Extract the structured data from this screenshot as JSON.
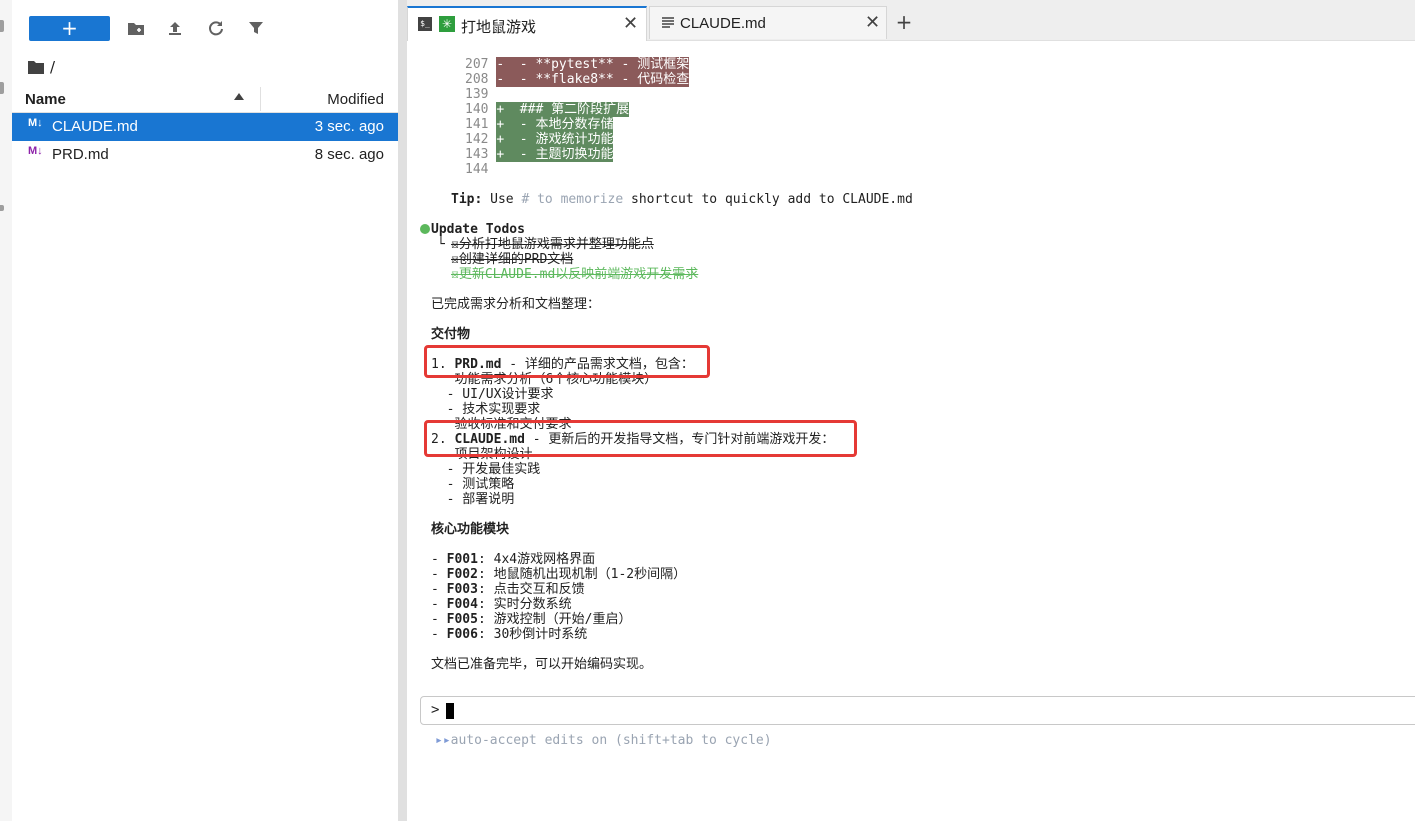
{
  "filebrowser": {
    "new_button_label": "+",
    "toolbar_icons": [
      "new-folder-icon",
      "upload-icon",
      "refresh-icon",
      "filter-icon"
    ],
    "breadcrumb": "/",
    "columns": {
      "name": "Name",
      "modified": "Modified"
    },
    "files": [
      {
        "icon_label": "M↓",
        "name": "CLAUDE.md",
        "modified": "3 sec. ago",
        "selected": true
      },
      {
        "icon_label": "M↓",
        "name": "PRD.md",
        "modified": "8 sec. ago",
        "selected": false
      }
    ]
  },
  "tabs": [
    {
      "label": "打地鼠游戏",
      "icons": [
        "terminal-icon",
        "claude-icon"
      ],
      "close": "✕",
      "active": true
    },
    {
      "label": "CLAUDE.md",
      "icons": [
        "document-icon"
      ],
      "close": "✕",
      "active": false
    }
  ],
  "add_tab_label": "+",
  "terminal": {
    "diff": [
      {
        "num": "207",
        "type": "del",
        "text": "-  - **pytest** - 测试框架"
      },
      {
        "num": "208",
        "type": "del",
        "text": "-  - **flake8** - 代码检查"
      },
      {
        "num": "139",
        "type": "ctx",
        "text": ""
      },
      {
        "num": "140",
        "type": "add",
        "text": "+  ### 第二阶段扩展"
      },
      {
        "num": "141",
        "type": "add",
        "text": "+  - 本地分数存储"
      },
      {
        "num": "142",
        "type": "add",
        "text": "+  - 游戏统计功能"
      },
      {
        "num": "143",
        "type": "add",
        "text": "+  - 主题切换功能"
      },
      {
        "num": "144",
        "type": "ctx",
        "text": ""
      }
    ],
    "tip_label": "Tip:",
    "tip_pre": " Use ",
    "tip_hint": "# to memorize",
    "tip_post": " shortcut to quickly add to CLAUDE.md",
    "todos_title": "Update Todos",
    "todo_branch": "└",
    "todos": [
      {
        "text": "☒分析打地鼠游戏需求并整理功能点",
        "state": "done"
      },
      {
        "text": "☒创建详细的PRD文档",
        "state": "done"
      },
      {
        "text": "☒更新CLAUDE.md以反映前端游戏开发需求",
        "state": "current"
      }
    ],
    "summary": "已完成需求分析和文档整理：",
    "deliverables_title": "交付物",
    "d1_num": "1. ",
    "d1_name": "PRD.md",
    "d1_desc": " - 详细的产品需求文档，包含：",
    "d1_items": [
      "   功能需求分析（6个核心功能模块）",
      "  - UI/UX设计要求",
      "  - 技术实现要求",
      "   验收标准和交付要求"
    ],
    "d2_num": "2. ",
    "d2_name": "CLAUDE.md",
    "d2_desc": " - 更新后的开发指导文档，专门针对前端游戏开发：",
    "d2_items": [
      "   项目架构设计",
      "  - 开发最佳实践",
      "  - 测试策略",
      "  - 部署说明"
    ],
    "core_title": "核心功能模块",
    "features": [
      {
        "id": "F001",
        "desc": "4x4游戏网格界面"
      },
      {
        "id": "F002",
        "desc": "地鼠随机出现机制（1-2秒间隔）"
      },
      {
        "id": "F003",
        "desc": "点击交互和反馈"
      },
      {
        "id": "F004",
        "desc": "实时分数系统"
      },
      {
        "id": "F005",
        "desc": "游戏控制（开始/重启）"
      },
      {
        "id": "F006",
        "desc": "30秒倒计时系统"
      }
    ],
    "closing": "文档已准备完毕，可以开始编码实现。",
    "prompt_symbol": ">",
    "status_arrows": "▸▸",
    "status_text": "auto-accept edits on",
    "status_hint": " (shift+tab to cycle)"
  },
  "colors": {
    "accent": "#1976d2",
    "diff_deleted": "#8b5a5a",
    "diff_added": "#5f8a5f",
    "highlight_box": "#e53935",
    "todo_done": "#5cb85c"
  }
}
